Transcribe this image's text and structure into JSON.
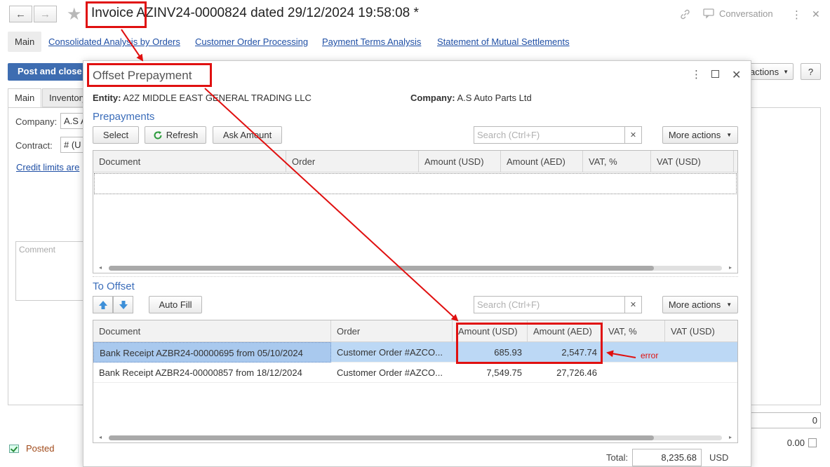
{
  "window": {
    "title": "Invoice AZINV24-0000824 dated 29/12/2024 19:58:08 *",
    "back_icon": "←",
    "forward_icon": "→",
    "conversation_label": "Conversation"
  },
  "top_tabs": {
    "main": "Main",
    "links": [
      "Consolidated Analysis by Orders",
      "Customer Order Processing",
      "Payment Terms Analysis",
      "Statement of Mutual Settlements"
    ]
  },
  "toolbar": {
    "post_and_close": "Post and close",
    "more_actions_tail": "actions",
    "help": "?"
  },
  "form": {
    "tab_main": "Main",
    "tab_inventory": "Inventory",
    "company_label": "Company:",
    "company_value": "A.S A",
    "contract_label": "Contract:",
    "contract_value": "# (U",
    "credit_limits_link": "Credit limits are",
    "comment_placeholder": "Comment",
    "status": "Posted",
    "right_value_1": "0",
    "right_value_2": "0.00"
  },
  "modal": {
    "title": "Offset Prepayment",
    "entity_label": "Entity:",
    "entity_value": "A2Z MIDDLE EAST GENERAL TRADING LLC",
    "company_label": "Company:",
    "company_value": "A.S Auto Parts Ltd",
    "prepayments": {
      "section_title": "Prepayments",
      "select": "Select",
      "refresh": "Refresh",
      "ask_amount": "Ask Amount",
      "search_placeholder": "Search (Ctrl+F)",
      "more_actions": "More actions",
      "columns": [
        "Document",
        "Order",
        "Amount (USD)",
        "Amount (AED)",
        "VAT, %",
        "VAT (USD)"
      ]
    },
    "to_offset": {
      "section_title": "To Offset",
      "auto_fill": "Auto Fill",
      "search_placeholder": "Search (Ctrl+F)",
      "more_actions": "More actions",
      "columns": [
        "Document",
        "Order",
        "Amount (USD)",
        "Amount (AED)",
        "VAT, %",
        "VAT (USD)"
      ],
      "rows": [
        {
          "document": "Bank Receipt AZBR24-00000695 from 05/10/2024",
          "order": "Customer Order #AZCO...",
          "amount_usd": "685.93",
          "amount_aed": "2,547.74",
          "vat_pct": "",
          "vat_usd": ""
        },
        {
          "document": "Bank Receipt AZBR24-00000857 from 18/12/2024",
          "order": "Customer Order #AZCO...",
          "amount_usd": "7,549.75",
          "amount_aed": "27,726.46",
          "vat_pct": "",
          "vat_usd": ""
        }
      ]
    },
    "total_label": "Total:",
    "total_value": "8,235.68",
    "total_currency": "USD"
  },
  "annotations": {
    "error_label": "error",
    "color": "#e01010"
  }
}
